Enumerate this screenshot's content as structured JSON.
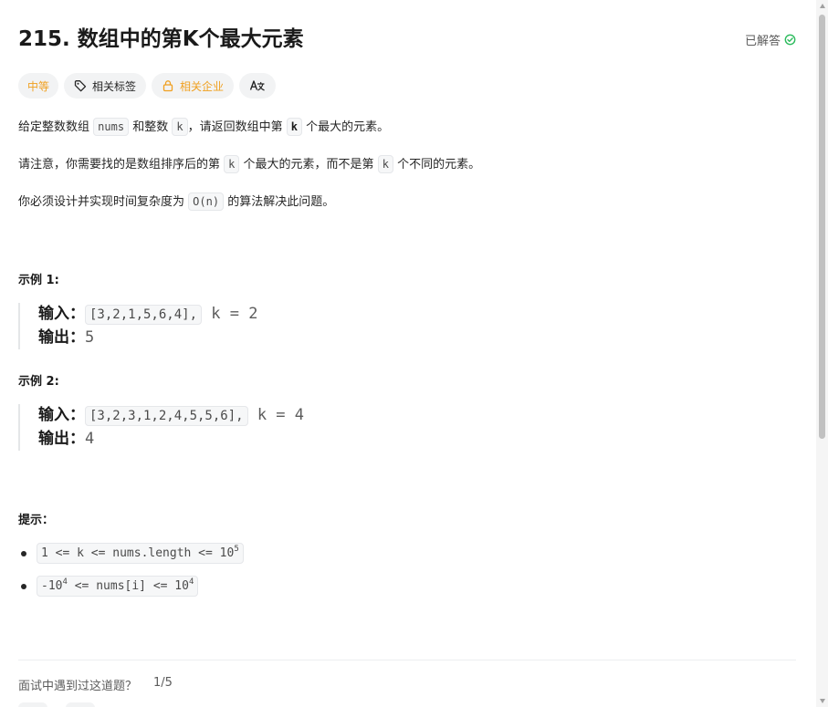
{
  "problem": {
    "title": "215. 数组中的第K个最大元素",
    "solved_label": "已解答"
  },
  "tags": {
    "difficulty": "中等",
    "related_topics": "相关标签",
    "companies": "相关企业",
    "translate_icon_text": "A文"
  },
  "description": {
    "p1": {
      "t1": "给定整数数组",
      "c1": "nums",
      "t2": "和整数",
      "c2": "k",
      "t3": "，请返回数组中第",
      "c3": "k",
      "t4": "个最大的元素。"
    },
    "p2": {
      "t1": "请注意，你需要找的是数组排序后的第",
      "c1": "k",
      "t2": "个最大的元素，而不是第",
      "c2": "k",
      "t3": "个不同的元素。"
    },
    "p3": {
      "t1": "你必须设计并实现时间复杂度为",
      "c1": "O(n)",
      "t2": "的算法解决此问题。"
    }
  },
  "examples": [
    {
      "title": "示例 1:",
      "input_label": "输入：",
      "input_code": "[3,2,1,5,6,4],",
      "input_rest": "k = 2",
      "output_label": "输出：",
      "output_value": "5"
    },
    {
      "title": "示例 2:",
      "input_label": "输入：",
      "input_code": "[3,2,3,1,2,4,5,5,6],",
      "input_rest": "k = 4",
      "output_label": "输出：",
      "output_value": "4"
    }
  ],
  "hints": {
    "title": "提示：",
    "h1": {
      "pre": "1 <= k <= nums.length <= 10",
      "sup": "5"
    },
    "h2": {
      "pre": "-10",
      "sup1": "4",
      "mid": " <= nums[i] <= 10",
      "sup2": "4"
    }
  },
  "interview": {
    "question": "面试中遇到过这道题？",
    "count": "1/5"
  },
  "colors": {
    "difficulty_medium": "#f0a020",
    "solved_green": "#2cbb5d"
  }
}
